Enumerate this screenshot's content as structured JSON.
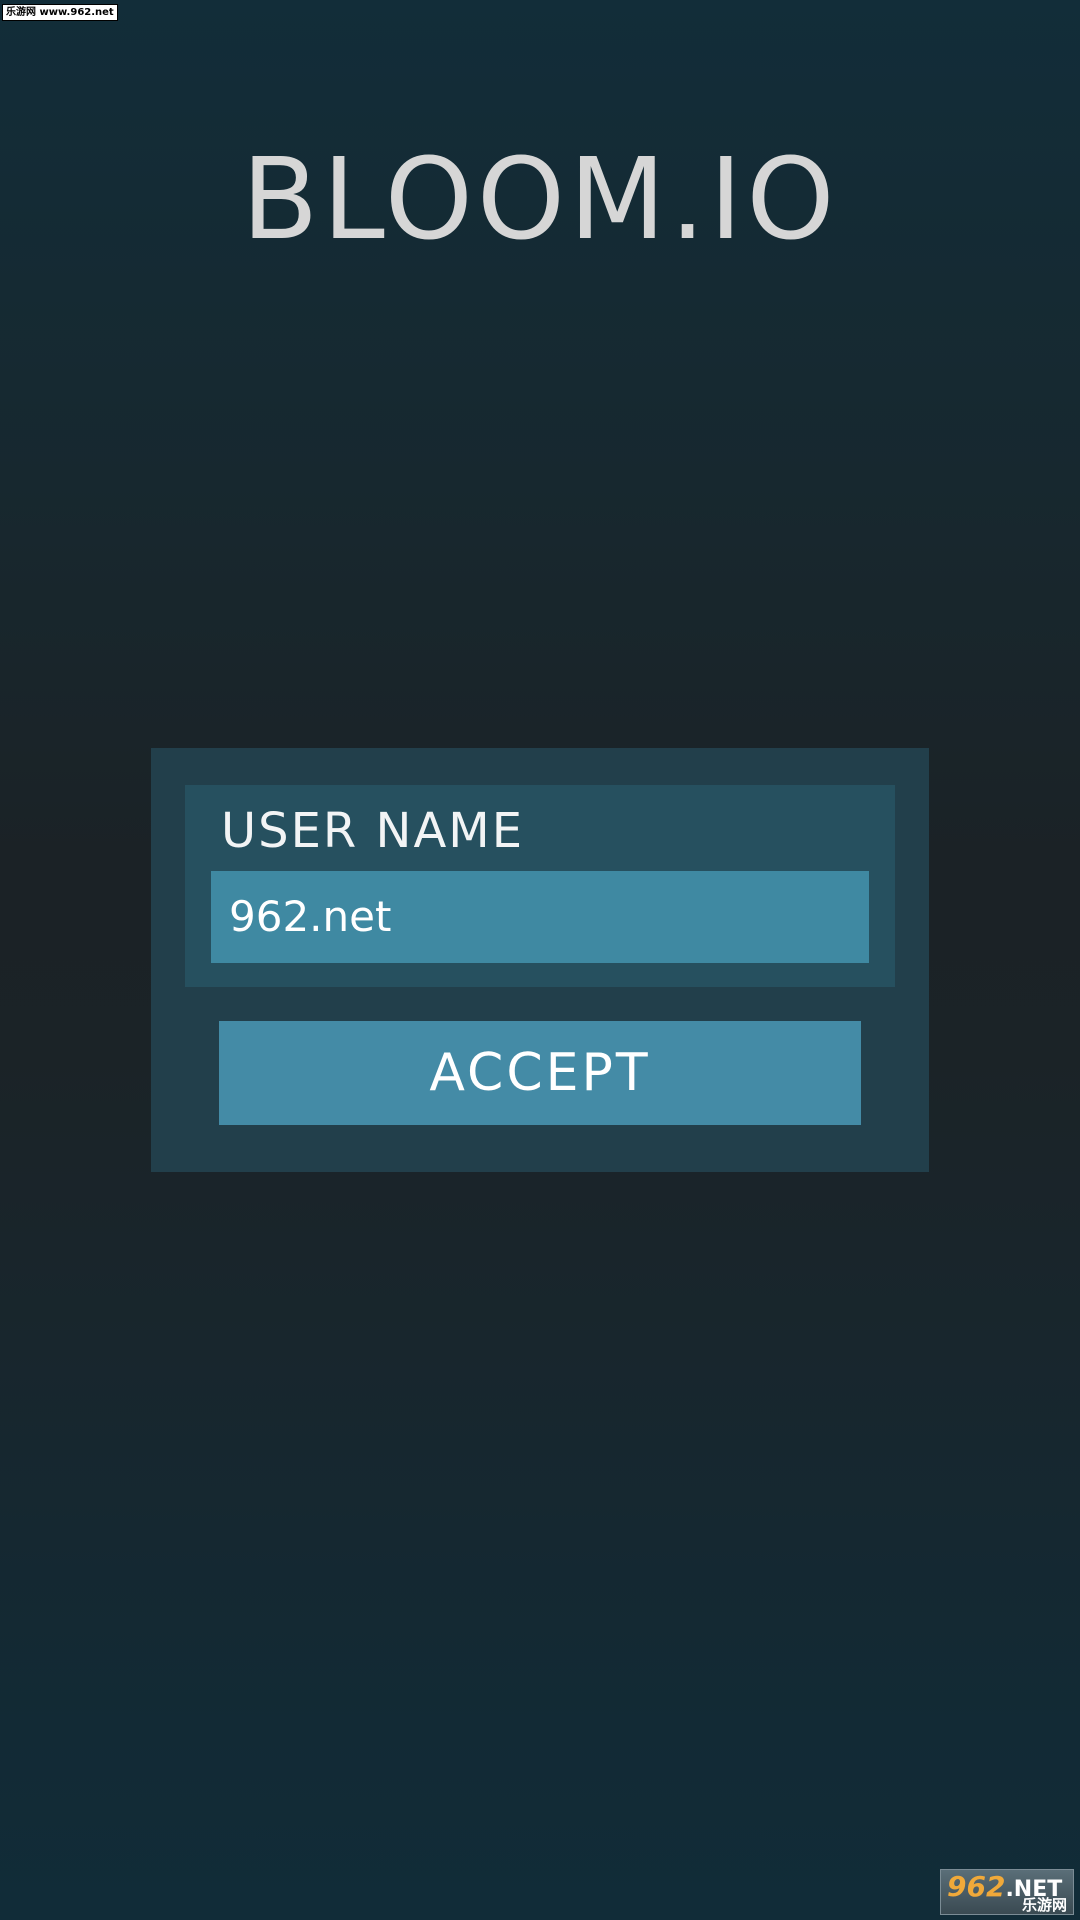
{
  "watermark_top": "乐游网 www.962.net",
  "game": {
    "title": "BLOOM.IO"
  },
  "login": {
    "username_label": "USER NAME",
    "username_value": "962.net",
    "accept_label": "ACCEPT"
  },
  "watermark_logo": {
    "main": "962",
    "suffix": ".NET",
    "sub": "乐游网"
  },
  "colors": {
    "background_top": "#122d39",
    "background_mid": "#1b2226",
    "panel": "#223f4b",
    "card": "#26505f",
    "input": "#3f89a2",
    "button": "#448ba6",
    "title_text": "#d6d6d6"
  }
}
